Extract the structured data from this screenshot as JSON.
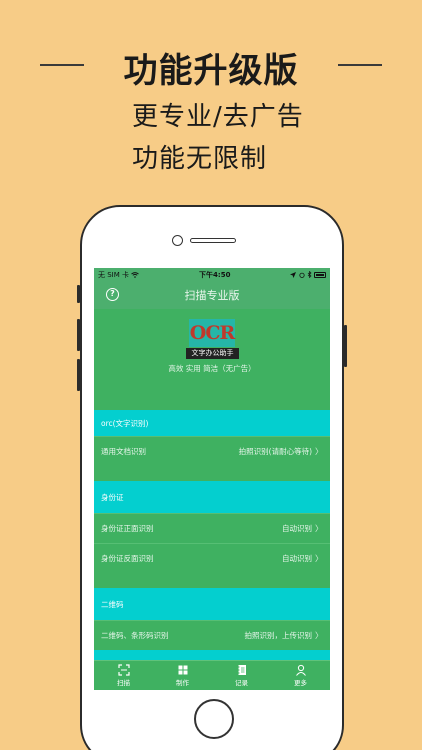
{
  "promo": {
    "title": "功能升级版",
    "line1": "更专业/去广告",
    "line2": "功能无限制"
  },
  "status_bar": {
    "carrier": "无 SIM 卡",
    "time": "下午4:50"
  },
  "nav": {
    "title": "扫描专业版",
    "help_glyph": "?"
  },
  "hero": {
    "logo_text": "OCR",
    "logo_caption": "文字办公助手",
    "tagline": "高效 实用 简洁（无广告）"
  },
  "sections": [
    {
      "header": "orc(文字识别)",
      "rows": [
        {
          "label": "通用文档识别",
          "value": "拍照识别(请耐心等待)"
        }
      ]
    },
    {
      "header": "身份证",
      "rows": [
        {
          "label": "身份证正面识别",
          "value": "自动识别"
        },
        {
          "label": "身份证反面识别",
          "value": "自动识别"
        }
      ]
    },
    {
      "header": "二维码",
      "rows": [
        {
          "label": "二维码、条形码识别",
          "value": "拍照识别，上传识别"
        }
      ]
    }
  ],
  "chevron": "〉",
  "tabs": [
    {
      "label": "扫描",
      "icon": "scan-icon"
    },
    {
      "label": "制作",
      "icon": "grid-icon"
    },
    {
      "label": "记录",
      "icon": "notebook-icon"
    },
    {
      "label": "更多",
      "icon": "user-icon"
    }
  ],
  "colors": {
    "background": "#f7cc87",
    "green": "#3fb161",
    "cyan": "#04cfcf",
    "nav_green": "#4caf6e"
  }
}
